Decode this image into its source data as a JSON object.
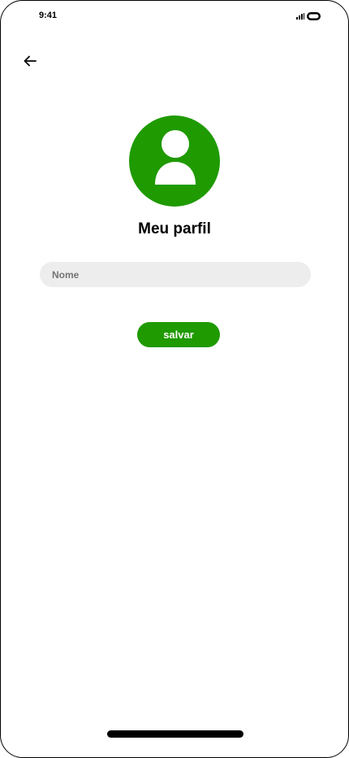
{
  "status_bar": {
    "time": "9:41",
    "icons": [
      "signal-icon",
      "battery-icon"
    ]
  },
  "header": {
    "back_icon": "arrow-left-icon"
  },
  "profile": {
    "avatar_icon": "user-icon",
    "title": "Meu parfil",
    "name_field": {
      "placeholder": "Nome",
      "value": ""
    },
    "save_label": "salvar"
  },
  "colors": {
    "accent": "#1f9a00",
    "field_background": "#ededed",
    "placeholder": "#747474"
  }
}
